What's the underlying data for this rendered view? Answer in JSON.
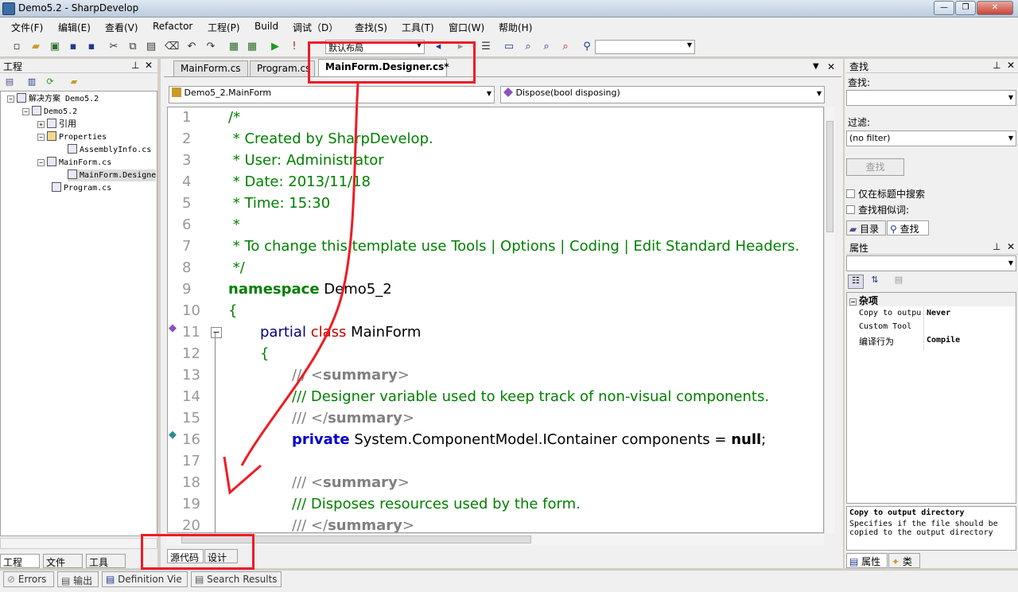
{
  "window": {
    "title": "Demo5.2 - SharpDevelop",
    "min": "—",
    "restore": "❐",
    "close": "✕"
  },
  "menu": [
    "文件(F)",
    "编辑(E)",
    "查看(V)",
    "Refactor",
    "工程(P)",
    "Build",
    "调试（D）",
    "查找(S)",
    "工具(T)",
    "窗口(W)",
    "帮助(H)"
  ],
  "toolbar": {
    "layout_combo": "默认布局"
  },
  "project_panel": {
    "title": "工程",
    "pin": "⊥",
    "close": "✕",
    "tree": [
      {
        "label": "解决方案 Demo5.2",
        "level": 0
      },
      {
        "label": "Demo5.2",
        "level": 1
      },
      {
        "label": "引用",
        "level": 2
      },
      {
        "label": "Properties",
        "level": 2
      },
      {
        "label": "AssemblyInfo.cs",
        "level": 3
      },
      {
        "label": "MainForm.cs",
        "level": 2
      },
      {
        "label": "MainForm.Designe",
        "level": 3
      },
      {
        "label": "Program.cs",
        "level": 2
      }
    ],
    "tabs": [
      "工程",
      "文件",
      "工具"
    ]
  },
  "editor": {
    "tabs": [
      "MainForm.cs",
      "Program.cs",
      "MainForm.Designer.cs*"
    ],
    "class_combo": "Demo5_2.MainForm",
    "member_combo": "Dispose(bool disposing)",
    "line_numbers": [
      "1",
      "2",
      "3",
      "4",
      "5",
      "6",
      "7",
      "8",
      "9",
      "10",
      "11",
      "12",
      "13",
      "14",
      "15",
      "16",
      "17",
      "18",
      "19",
      "20"
    ],
    "code": {
      "l1": "/*",
      "l2": " * Created by SharpDevelop.",
      "l3": " * User: Administrator",
      "l4": " * Date: 2013/11/18",
      "l5": " * Time: 15:30",
      "l6": " *",
      "l7": " * To change this template use Tools | Options | Coding | Edit Standard Headers.",
      "l8": " */",
      "l9_kw": "namespace",
      "l9_rest": " Demo5_2",
      "l10": "{",
      "l11_a": "partial",
      "l11_b": "class",
      "l11_c": " MainForm",
      "l12": "{",
      "l13_a": "/// <",
      "l13_b": "summary",
      "l13_c": ">",
      "l14": "/// Designer variable used to keep track of non-visual components.",
      "l15_a": "/// </",
      "l15_b": "summary",
      "l15_c": ">",
      "l16_a": "private",
      "l16_b": " System.ComponentModel.IContainer components = ",
      "l16_c": "null",
      "l16_d": ";",
      "l18_a": "/// <",
      "l18_b": "summary",
      "l18_c": ">",
      "l19": "/// Disposes resources used by the form.",
      "l20_a": "/// </",
      "l20_b": "summary",
      "l20_c": ">"
    },
    "view_tabs": [
      "源代码",
      "设计"
    ]
  },
  "find_panel": {
    "title": "查找",
    "find_label": "查找:",
    "filter_label": "过滤:",
    "filter_value": "(no filter)",
    "find_button": "查找",
    "check_title": "仅在标题中搜索",
    "check_similar": "查找相似词:",
    "tabs": [
      "目录",
      "查找"
    ]
  },
  "props_panel": {
    "title": "属性",
    "category": "杂项",
    "rows": [
      {
        "name": "Copy to outpu",
        "value": "Never"
      },
      {
        "name": "Custom Tool",
        "value": ""
      },
      {
        "name": "编译行为",
        "value": "Compile"
      }
    ],
    "desc_title": "Copy to output directory",
    "desc_text": "Specifies if the file should be copied to the output directory",
    "tabs": [
      "属性",
      "类"
    ]
  },
  "status_tabs": [
    "Errors",
    "输出",
    "Definition Vie",
    "Search Results"
  ],
  "colors": {
    "annotation": "#ee1c24",
    "comment": "#008000",
    "keyword_blue": "#0000cc"
  }
}
